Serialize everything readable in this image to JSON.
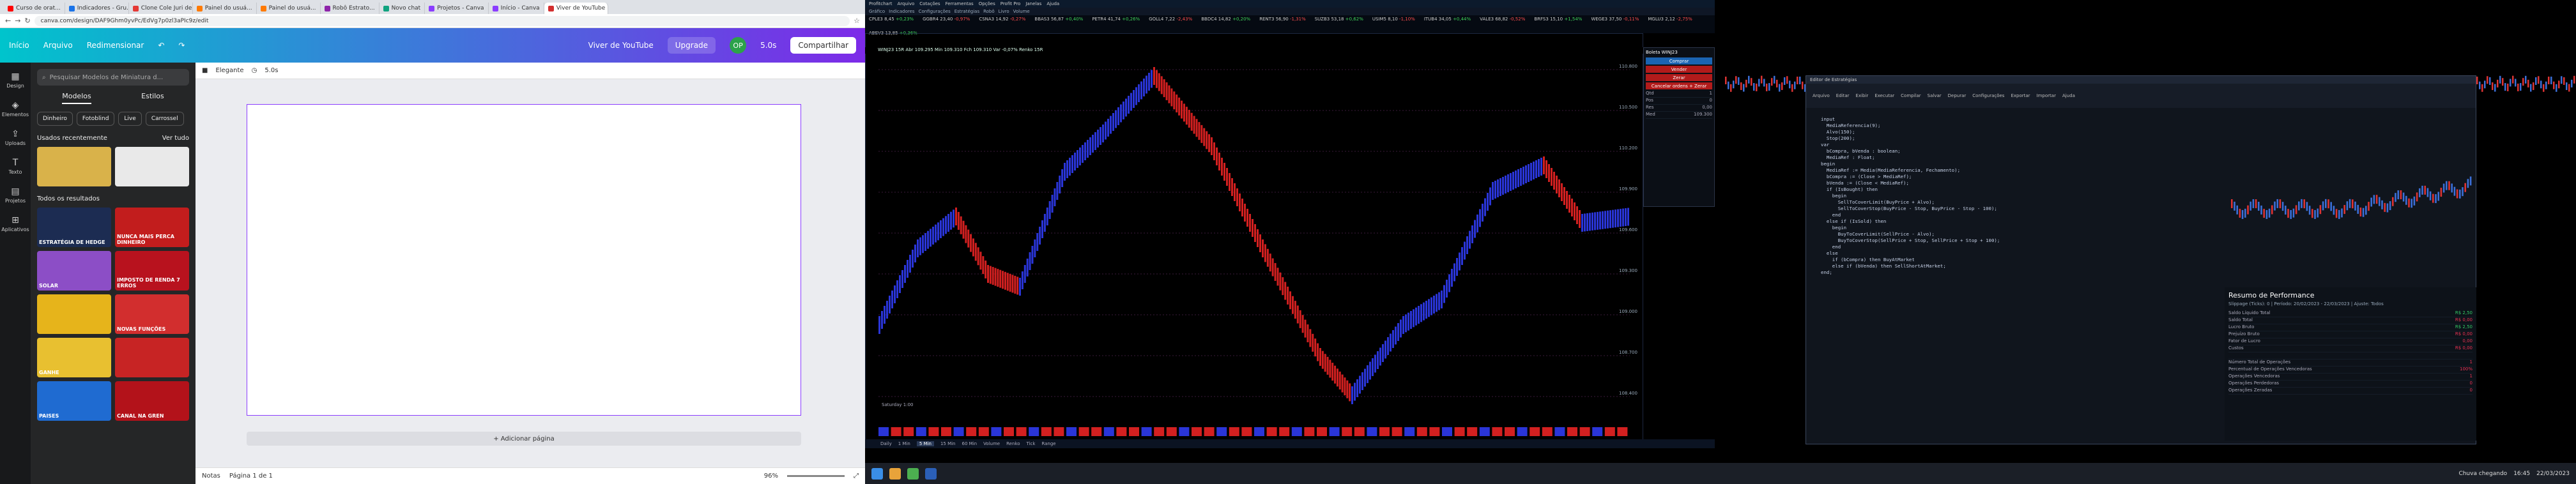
{
  "browser": {
    "tabs": [
      {
        "label": "Curso de orat..."
      },
      {
        "label": "Indicadores - Gru..."
      },
      {
        "label": "Clone Cole Juri de..."
      },
      {
        "label": "Painel do usuá..."
      },
      {
        "label": "Painel do usuá..."
      },
      {
        "label": "Robô Estrato..."
      },
      {
        "label": "Novo chat"
      },
      {
        "label": "Projetos - Canva"
      },
      {
        "label": "Início - Canva"
      },
      {
        "label": "Viver de YouTube"
      }
    ],
    "url": "canva.com/design/DAF9Ghm0yvPc/EdVg7p0zl3aPIc9z/edit"
  },
  "canva": {
    "home": "Início",
    "file": "Arquivo",
    "resize": "Redimensionar",
    "title": "Viver de YouTube",
    "upgrade": "Upgrade",
    "avatar": "OP",
    "time": "5.0s",
    "share": "Compartilhar",
    "rail": [
      "Design",
      "Elementos",
      "Uploads",
      "Texto",
      "Projetos",
      "Aplicativos"
    ],
    "search_placeholder": "Pesquisar Modelos de Miniatura d...",
    "panel_tabs": [
      "Modelos",
      "Estilos"
    ],
    "chips": [
      "Dinheiro",
      "Fotoblind",
      "Live",
      "Carrossel"
    ],
    "recent": "Usados recentemente",
    "see_all": "Ver tudo",
    "all_results": "Todos os resultados",
    "thumbs": [
      "",
      "",
      "ESTRATÉGIA DE HEDGE",
      "NUNCA MAIS PERCA DINHEIRO",
      "SOLAR",
      "IMPOSTO DE RENDA 7 ERROS",
      "",
      "NOVAS FUNÇÕES",
      "GANHE",
      "",
      "PAISES",
      "CANAL NA GREN"
    ],
    "toolbar": {
      "color": "Elegante",
      "duration": "5.0s"
    },
    "add_page": "+ Adicionar página",
    "notes": "Notas",
    "page_label": "Página 1 de 1",
    "zoom": "96%"
  },
  "platform": {
    "menu": [
      "Profitchart",
      "Arquivo",
      "Cotações",
      "Ferramentas",
      "Opções",
      "Profit Pro",
      "Janelas",
      "Ajuda"
    ],
    "toolbar": [
      "Gráfico",
      "Indicadores",
      "Configurações",
      "Estratégias",
      "Robô",
      "Livro",
      "Volume"
    ],
    "tickers": [
      {
        "s": "CPLE3",
        "v": "8,45",
        "d": "+0,23%",
        "up": true
      },
      {
        "s": "GGBR4",
        "v": "23,40",
        "d": "-0,97%",
        "up": false
      },
      {
        "s": "CSNA3",
        "v": "14,92",
        "d": "-0,27%",
        "up": false
      },
      {
        "s": "BBAS3",
        "v": "56,87",
        "d": "+0,40%",
        "up": true
      },
      {
        "s": "PETR4",
        "v": "41,74",
        "d": "+0,26%",
        "up": true
      },
      {
        "s": "GOLL4",
        "v": "7,22",
        "d": "-2,43%",
        "up": false
      },
      {
        "s": "BBDC4",
        "v": "14,82",
        "d": "+0,20%",
        "up": true
      },
      {
        "s": "RENT3",
        "v": "56,90",
        "d": "-1,31%",
        "up": false
      },
      {
        "s": "SUZB3",
        "v": "53,18",
        "d": "+0,62%",
        "up": true
      },
      {
        "s": "USIM5",
        "v": "8,10",
        "d": "-1,10%",
        "up": false
      },
      {
        "s": "ITUB4",
        "v": "34,05",
        "d": "+0,44%",
        "up": true
      },
      {
        "s": "VALE3",
        "v": "68,82",
        "d": "-0,52%",
        "up": false
      },
      {
        "s": "BRFS3",
        "v": "15,10",
        "d": "+1,54%",
        "up": true
      },
      {
        "s": "WEGE3",
        "v": "37,50",
        "d": "-0,11%",
        "up": false
      },
      {
        "s": "MGLU3",
        "v": "2,12",
        "d": "-2,75%",
        "up": false
      },
      {
        "s": "ABEV3",
        "v": "13,85",
        "d": "+0,36%",
        "up": true
      }
    ],
    "chart_header": "WINJ23 15R  Abr 109.295 Min 109.310 Fch 109.310 Var -0,07%  Renko 15R",
    "price_ticks": [
      "110.800",
      "110.500",
      "110.200",
      "109.900",
      "109.600",
      "109.300",
      "109.000",
      "108.700",
      "108.400"
    ],
    "volume_label": "Saturday 1:00",
    "bottom_tabs": [
      "Daily",
      "1 Min",
      "5 Min",
      "15 Min",
      "60 Min",
      "Volume",
      "Renko",
      "Tick",
      "Range"
    ],
    "side": {
      "title": "Boleta WINJ23",
      "buy": "Comprar",
      "sell": "Vender",
      "zero": "Zerar",
      "cancel": "Cancelar ordens + Zerar",
      "rows": [
        [
          "Qtd",
          "1"
        ],
        [
          "Pos",
          "0"
        ],
        [
          "Res",
          "0,00"
        ],
        [
          "Med",
          "109.300"
        ]
      ]
    }
  },
  "editor": {
    "title": "Editor de Estratégias",
    "ribbon": [
      "Arquivo",
      "Editar",
      "Exibir",
      "Executar",
      "Compilar",
      "Salvar",
      "Depurar",
      "Configurações",
      "Exportar",
      "Importar",
      "Ajuda"
    ],
    "code": [
      "input",
      "  MediaReferencia(9);",
      "  Alvo(150);",
      "  Stop(200);",
      "var",
      "  bCompra, bVenda : boolean;",
      "  MediaRef : Float;",
      "begin",
      "  MediaRef := Media(MediaReferencia, Fechamento);",
      "  bCompra := (Close > MediaRef);",
      "  bVenda := (Close < MediaRef);",
      "",
      "  if (IsBought) then",
      "    begin",
      "      SellToCoverLimit(BuyPrice + Alvo);",
      "      SellToCoverStop(BuyPrice - Stop, BuyPrice - Stop - 100);",
      "    end",
      "  else if (IsSold) then",
      "    begin",
      "      BuyToCoverLimit(SellPrice - Alvo);",
      "      BuyToCoverStop(SellPrice + Stop, SellPrice + Stop + 100);",
      "    end",
      "  else",
      "    if (bCompra) then BuyAtMarket",
      "    else if (bVenda) then SellShortAtMarket;",
      "end;"
    ]
  },
  "performance": {
    "title": "Resumo de Performance",
    "subtitle": "Slippage (Ticks): 0 | Período: 20/02/2023 - 22/03/2023 | Ajuste: Todos",
    "rows": [
      [
        "Saldo Líquido Total",
        "R$ 2,50"
      ],
      [
        "Saldo Total",
        "R$ 0,00"
      ],
      [
        "Lucro Bruto",
        "R$ 2,50"
      ],
      [
        "Prejuízo Bruto",
        "R$ 0,00"
      ],
      [
        "Fator de Lucro",
        "0,00"
      ],
      [
        "Custos",
        "R$ 0,00"
      ],
      [
        "",
        ""
      ],
      [
        "Número Total de Operações",
        "1"
      ],
      [
        "Percentual de Operações Vencedoras",
        "100%"
      ],
      [
        "Operações Vencedoras",
        "1"
      ],
      [
        "Operações Perdedoras",
        "0"
      ],
      [
        "Operações Zeradas",
        "0"
      ]
    ]
  },
  "taskbar": {
    "weather": "Chuva chegando",
    "time": "16:45",
    "date": "22/03/2023"
  }
}
